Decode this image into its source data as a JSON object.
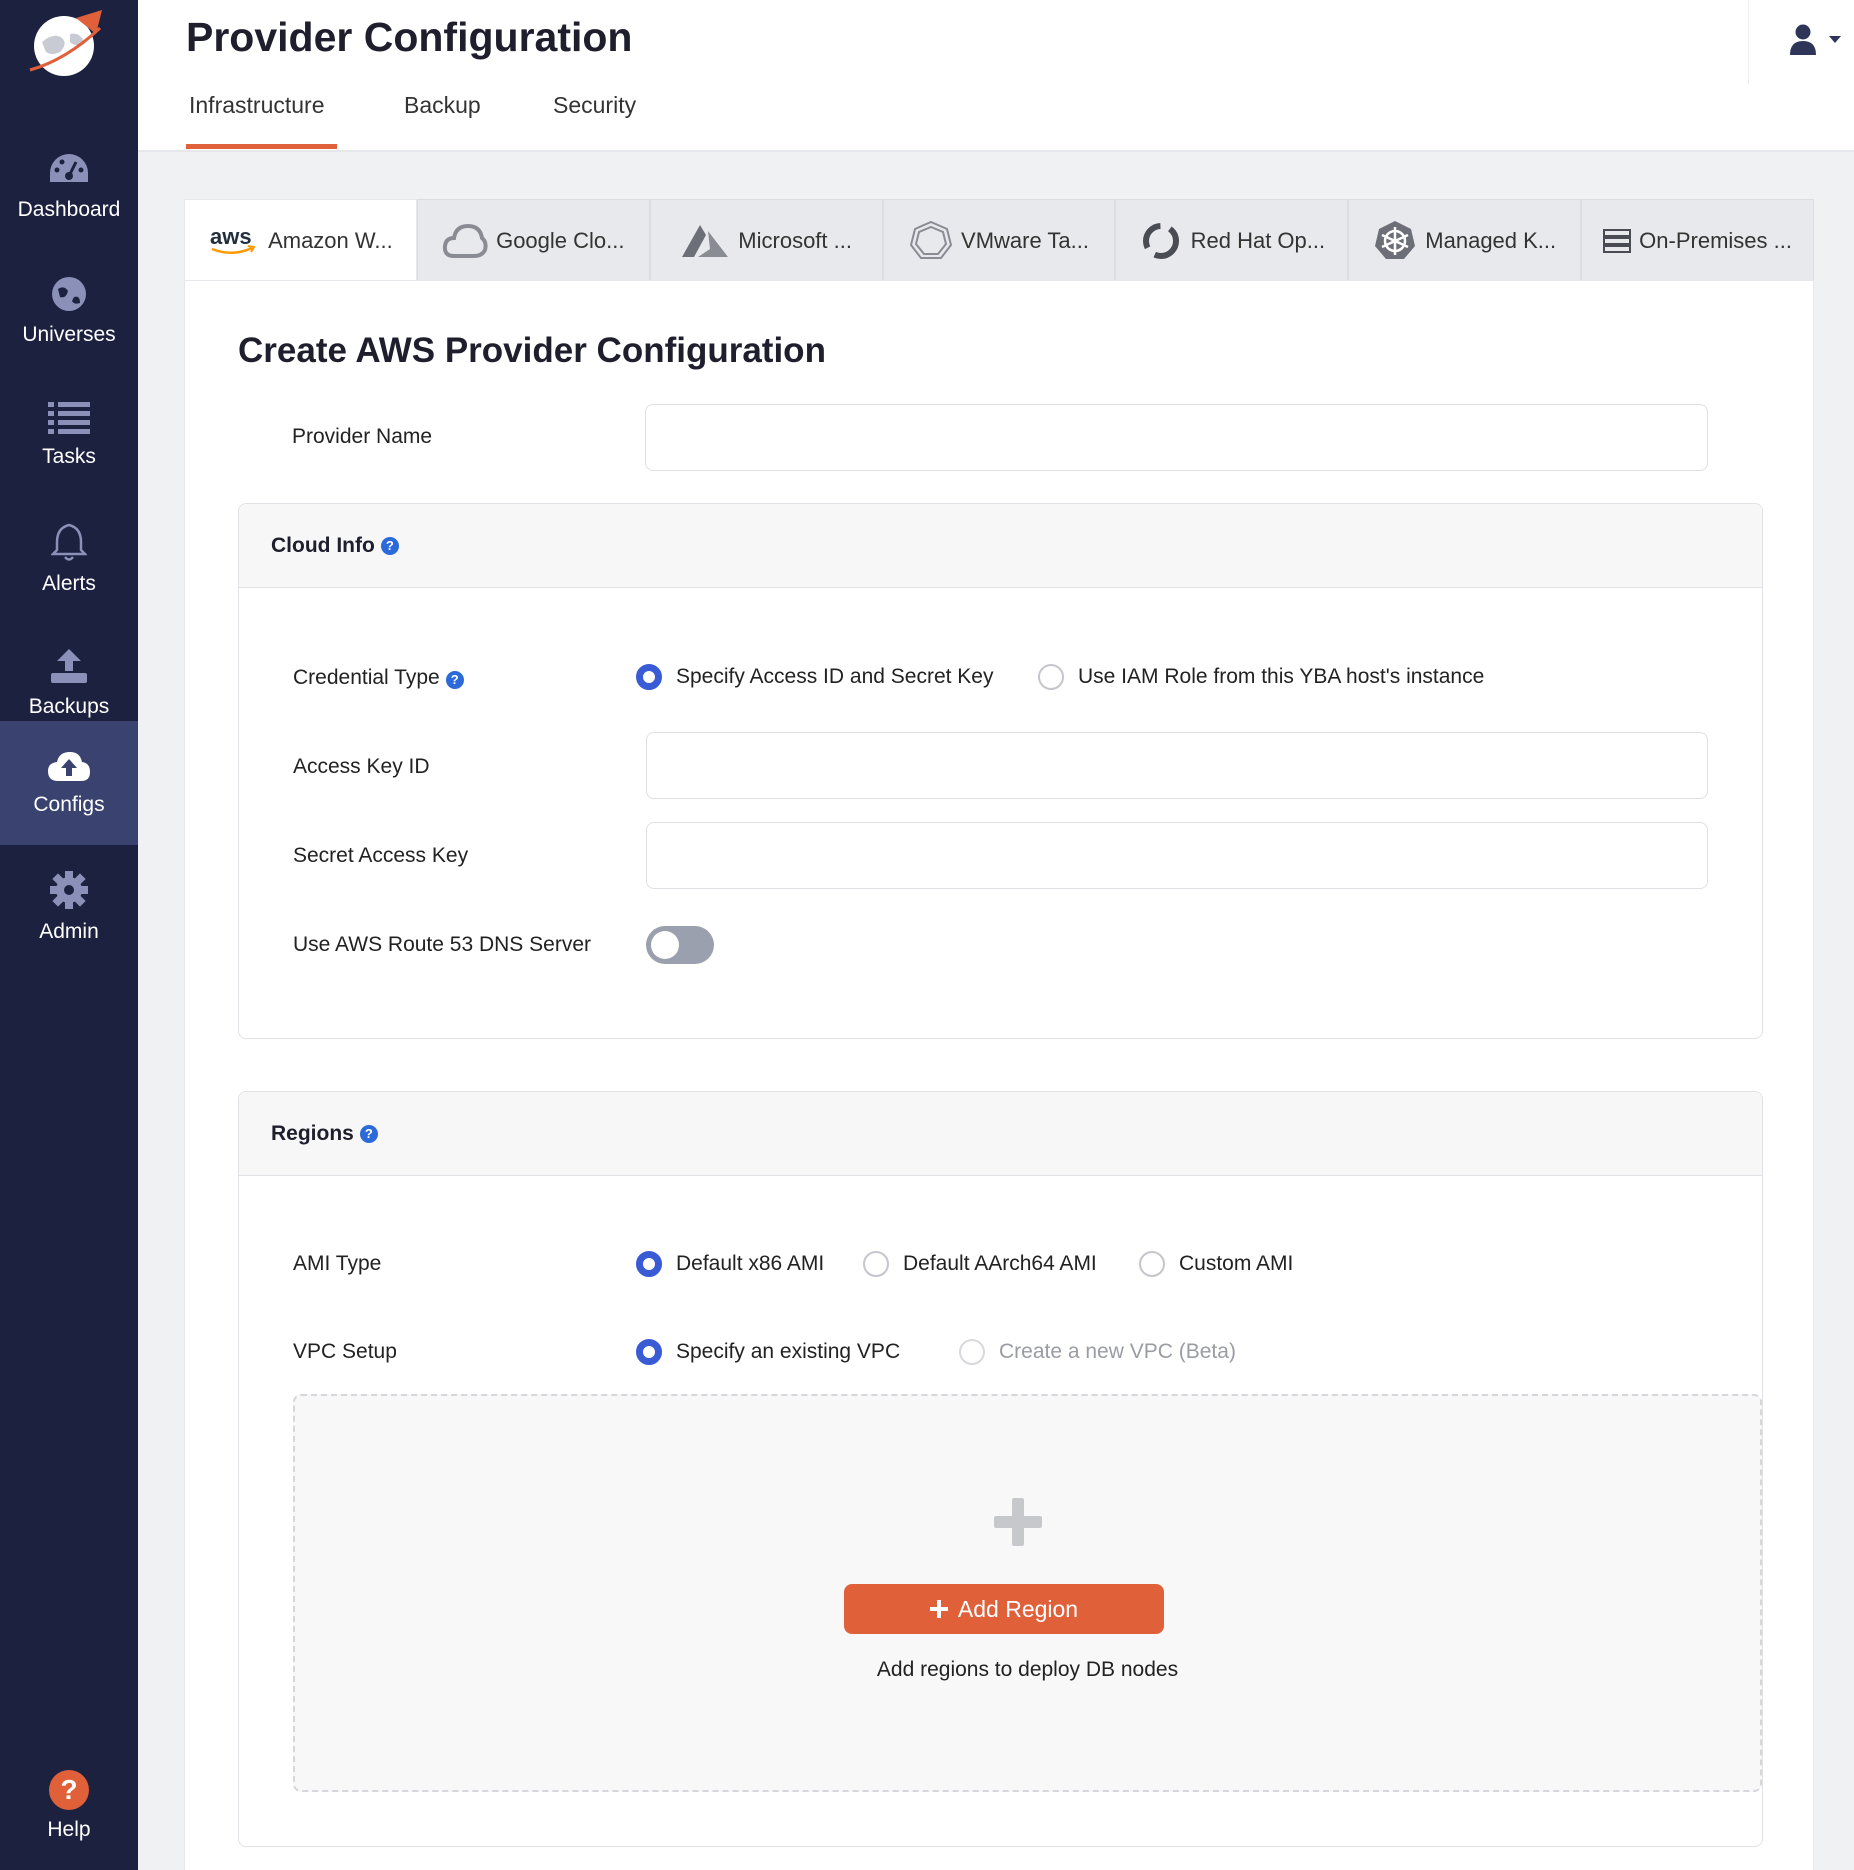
{
  "sidebar": {
    "items": [
      {
        "label": "Dashboard",
        "icon": "dashboard-icon"
      },
      {
        "label": "Universes",
        "icon": "globe-icon"
      },
      {
        "label": "Tasks",
        "icon": "list-icon"
      },
      {
        "label": "Alerts",
        "icon": "bell-icon"
      },
      {
        "label": "Backups",
        "icon": "upload-icon"
      },
      {
        "label": "Configs",
        "icon": "cloud-upload-icon",
        "active": true
      },
      {
        "label": "Admin",
        "icon": "gear-icon"
      }
    ],
    "help_label": "Help"
  },
  "header": {
    "title": "Provider Configuration",
    "tabs": [
      "Infrastructure",
      "Backup",
      "Security"
    ],
    "active_tab": "Infrastructure"
  },
  "provider_tabs": [
    {
      "label": "Amazon W...",
      "icon": "aws-icon",
      "active": true
    },
    {
      "label": "Google Clo...",
      "icon": "gcp-icon"
    },
    {
      "label": "Microsoft ...",
      "icon": "azure-icon"
    },
    {
      "label": "VMware Ta...",
      "icon": "vmware-icon"
    },
    {
      "label": "Red Hat Op...",
      "icon": "openshift-icon"
    },
    {
      "label": "Managed K...",
      "icon": "kubernetes-icon"
    },
    {
      "label": "On-Premises ...",
      "icon": "server-icon"
    }
  ],
  "form": {
    "title": "Create AWS Provider Configuration",
    "provider_name_label": "Provider Name",
    "provider_name_value": "",
    "cloud_info": {
      "heading": "Cloud Info",
      "credential_type_label": "Credential Type",
      "credential_options": [
        "Specify Access ID and Secret Key",
        "Use IAM Role from this YBA host's instance"
      ],
      "credential_selected": "Specify Access ID and Secret Key",
      "access_key_label": "Access Key ID",
      "access_key_value": "",
      "secret_key_label": "Secret Access Key",
      "secret_key_value": "",
      "route53_label": "Use AWS Route 53 DNS Server",
      "route53_enabled": false
    },
    "regions": {
      "heading": "Regions",
      "ami_type_label": "AMI Type",
      "ami_options": [
        "Default x86 AMI",
        "Default AArch64 AMI",
        "Custom AMI"
      ],
      "ami_selected": "Default x86 AMI",
      "vpc_label": "VPC Setup",
      "vpc_options": [
        "Specify an existing VPC",
        "Create a new VPC (Beta)"
      ],
      "vpc_selected": "Specify an existing VPC",
      "add_region_label": "Add Region",
      "add_region_hint": "Add regions to deploy DB nodes"
    }
  },
  "colors": {
    "sidebar_bg": "#1c2140",
    "sidebar_active": "#3a4270",
    "accent": "#e0603a",
    "radio_selected": "#3a5bd6",
    "help_blue": "#2b6ad8"
  }
}
